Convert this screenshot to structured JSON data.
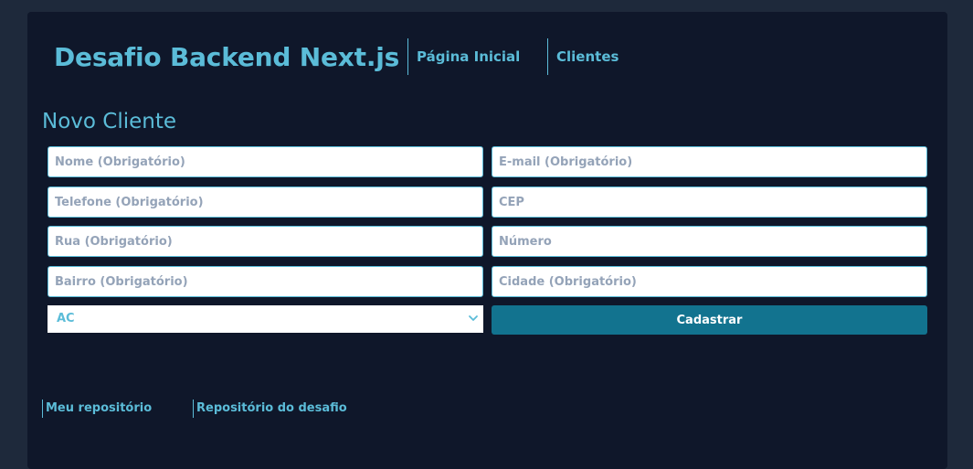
{
  "header": {
    "brand": "Desafio Backend Next.js",
    "nav": [
      {
        "label": "Página Inicial"
      },
      {
        "label": "Clientes"
      }
    ]
  },
  "form": {
    "title": "Novo Cliente",
    "fields": {
      "nome": {
        "placeholder": "Nome (Obrigatório)",
        "value": ""
      },
      "email": {
        "placeholder": "E-mail (Obrigatório)",
        "value": ""
      },
      "telefone": {
        "placeholder": "Telefone (Obrigatório)",
        "value": ""
      },
      "cep": {
        "placeholder": "CEP",
        "value": ""
      },
      "rua": {
        "placeholder": "Rua (Obrigatório)",
        "value": ""
      },
      "numero": {
        "placeholder": "Número",
        "value": ""
      },
      "bairro": {
        "placeholder": "Bairro (Obrigatório)",
        "value": ""
      },
      "cidade": {
        "placeholder": "Cidade (Obrigatório)",
        "value": ""
      }
    },
    "state_select": {
      "selected": "AC",
      "icon": "chevron-down-icon"
    },
    "submit_label": "Cadastrar"
  },
  "footer": {
    "links": [
      {
        "label": "Meu repositório"
      },
      {
        "label": "Repositório do desafio"
      }
    ]
  },
  "colors": {
    "page_bg": "#1e293b",
    "card_bg": "#0f172a",
    "accent": "#5bbcd8",
    "button_bg": "#12738f",
    "placeholder": "#94a3b8"
  }
}
